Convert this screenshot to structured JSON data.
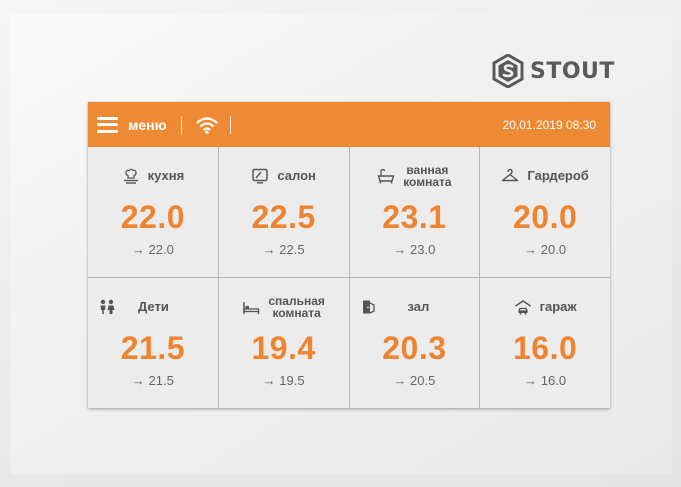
{
  "brand": {
    "name": "STOUT"
  },
  "header": {
    "menu_label": "меню",
    "datetime": "20.01.2019 08:30"
  },
  "zones": [
    {
      "name": "кухня",
      "name2": "",
      "temp": "22.0",
      "setpoint": "→ 22.0",
      "icon": "kitchen-icon"
    },
    {
      "name": "салон",
      "name2": "",
      "temp": "22.5",
      "setpoint": "→ 22.5",
      "icon": "tv-icon"
    },
    {
      "name": "ванная",
      "name2": "комната",
      "temp": "23.1",
      "setpoint": "→ 23.0",
      "icon": "bathtub-icon"
    },
    {
      "name": "Гардероб",
      "name2": "",
      "temp": "20.0",
      "setpoint": "→ 20.0",
      "icon": "hanger-icon"
    },
    {
      "name": "Дети",
      "name2": "",
      "temp": "21.5",
      "setpoint": "→ 21.5",
      "icon": "children-icon"
    },
    {
      "name": "спальная",
      "name2": "комната",
      "temp": "19.4",
      "setpoint": "→ 19.5",
      "icon": "bed-icon"
    },
    {
      "name": "зал",
      "name2": "",
      "temp": "20.3",
      "setpoint": "→ 20.5",
      "icon": "door-icon"
    },
    {
      "name": "гараж",
      "name2": "",
      "temp": "16.0",
      "setpoint": "→ 16.0",
      "icon": "garage-icon"
    }
  ],
  "colors": {
    "accent": "#ef8a34",
    "temp_text": "#ee8430",
    "tile_bg": "#ececec"
  }
}
